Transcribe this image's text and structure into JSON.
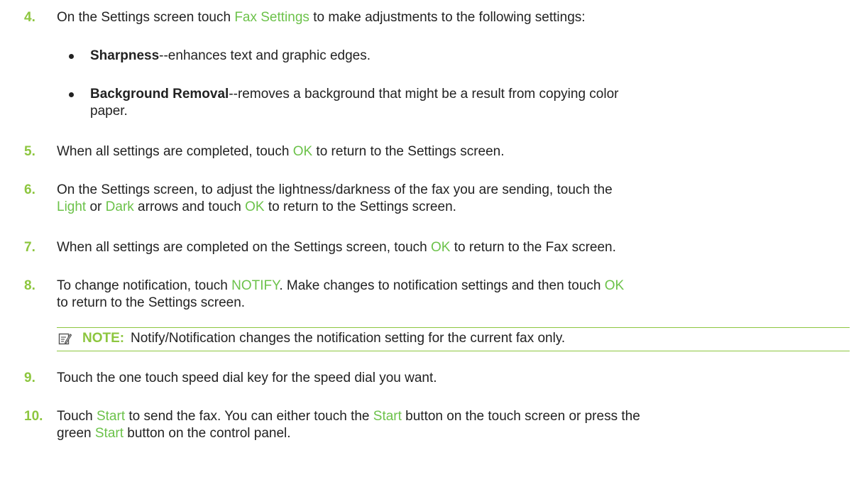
{
  "colors": {
    "accent": "#8dc63f",
    "link": "#6cc24a",
    "text": "#222222"
  },
  "steps": {
    "s4": {
      "num": "4.",
      "a": "On the Settings screen touch ",
      "link1": "Fax Settings",
      "b": " to make adjustments to the following settings:"
    },
    "bullets": [
      {
        "term": "Sharpness",
        "text": "--enhances text and graphic edges."
      },
      {
        "term": "Background Removal",
        "text": "--removes a background that might be a result from copying color",
        "cont": "paper."
      }
    ],
    "s5": {
      "num": "5.",
      "a": "When all settings are completed, touch ",
      "link1": "OK",
      "b": " to return to the Settings screen."
    },
    "s6": {
      "num": "6.",
      "a": "On the Settings screen, to adjust the lightness/darkness of the fax you are sending, touch the",
      "link1": "Light",
      "b": " or ",
      "link2": "Dark",
      "c": " arrows and touch ",
      "link3": "OK",
      "d": " to return to the Settings screen."
    },
    "s7": {
      "num": "7.",
      "a": "When all settings are completed on the Settings screen, touch ",
      "link1": "OK",
      "b": " to return to the Fax screen."
    },
    "s8": {
      "num": "8.",
      "a": "To change notification, touch ",
      "link1": "NOTIFY",
      "b": ". Make changes to notification settings and then touch ",
      "link2": "OK",
      "c": "to return to the Settings screen."
    },
    "note": {
      "icon": "note-pencil-icon",
      "label": "NOTE:",
      "text": "Notify/Notification changes the notification setting for the current fax only."
    },
    "s9": {
      "num": "9.",
      "a": "Touch the one touch speed dial key for the speed dial you want."
    },
    "s10": {
      "num": "10.",
      "a": "Touch ",
      "link1": "Start",
      "b": " to send the fax. You can either touch the ",
      "link2": "Start",
      "c": " button on the touch screen or press the",
      "d": "green ",
      "link3": "Start",
      "e": " button on the control panel."
    }
  }
}
